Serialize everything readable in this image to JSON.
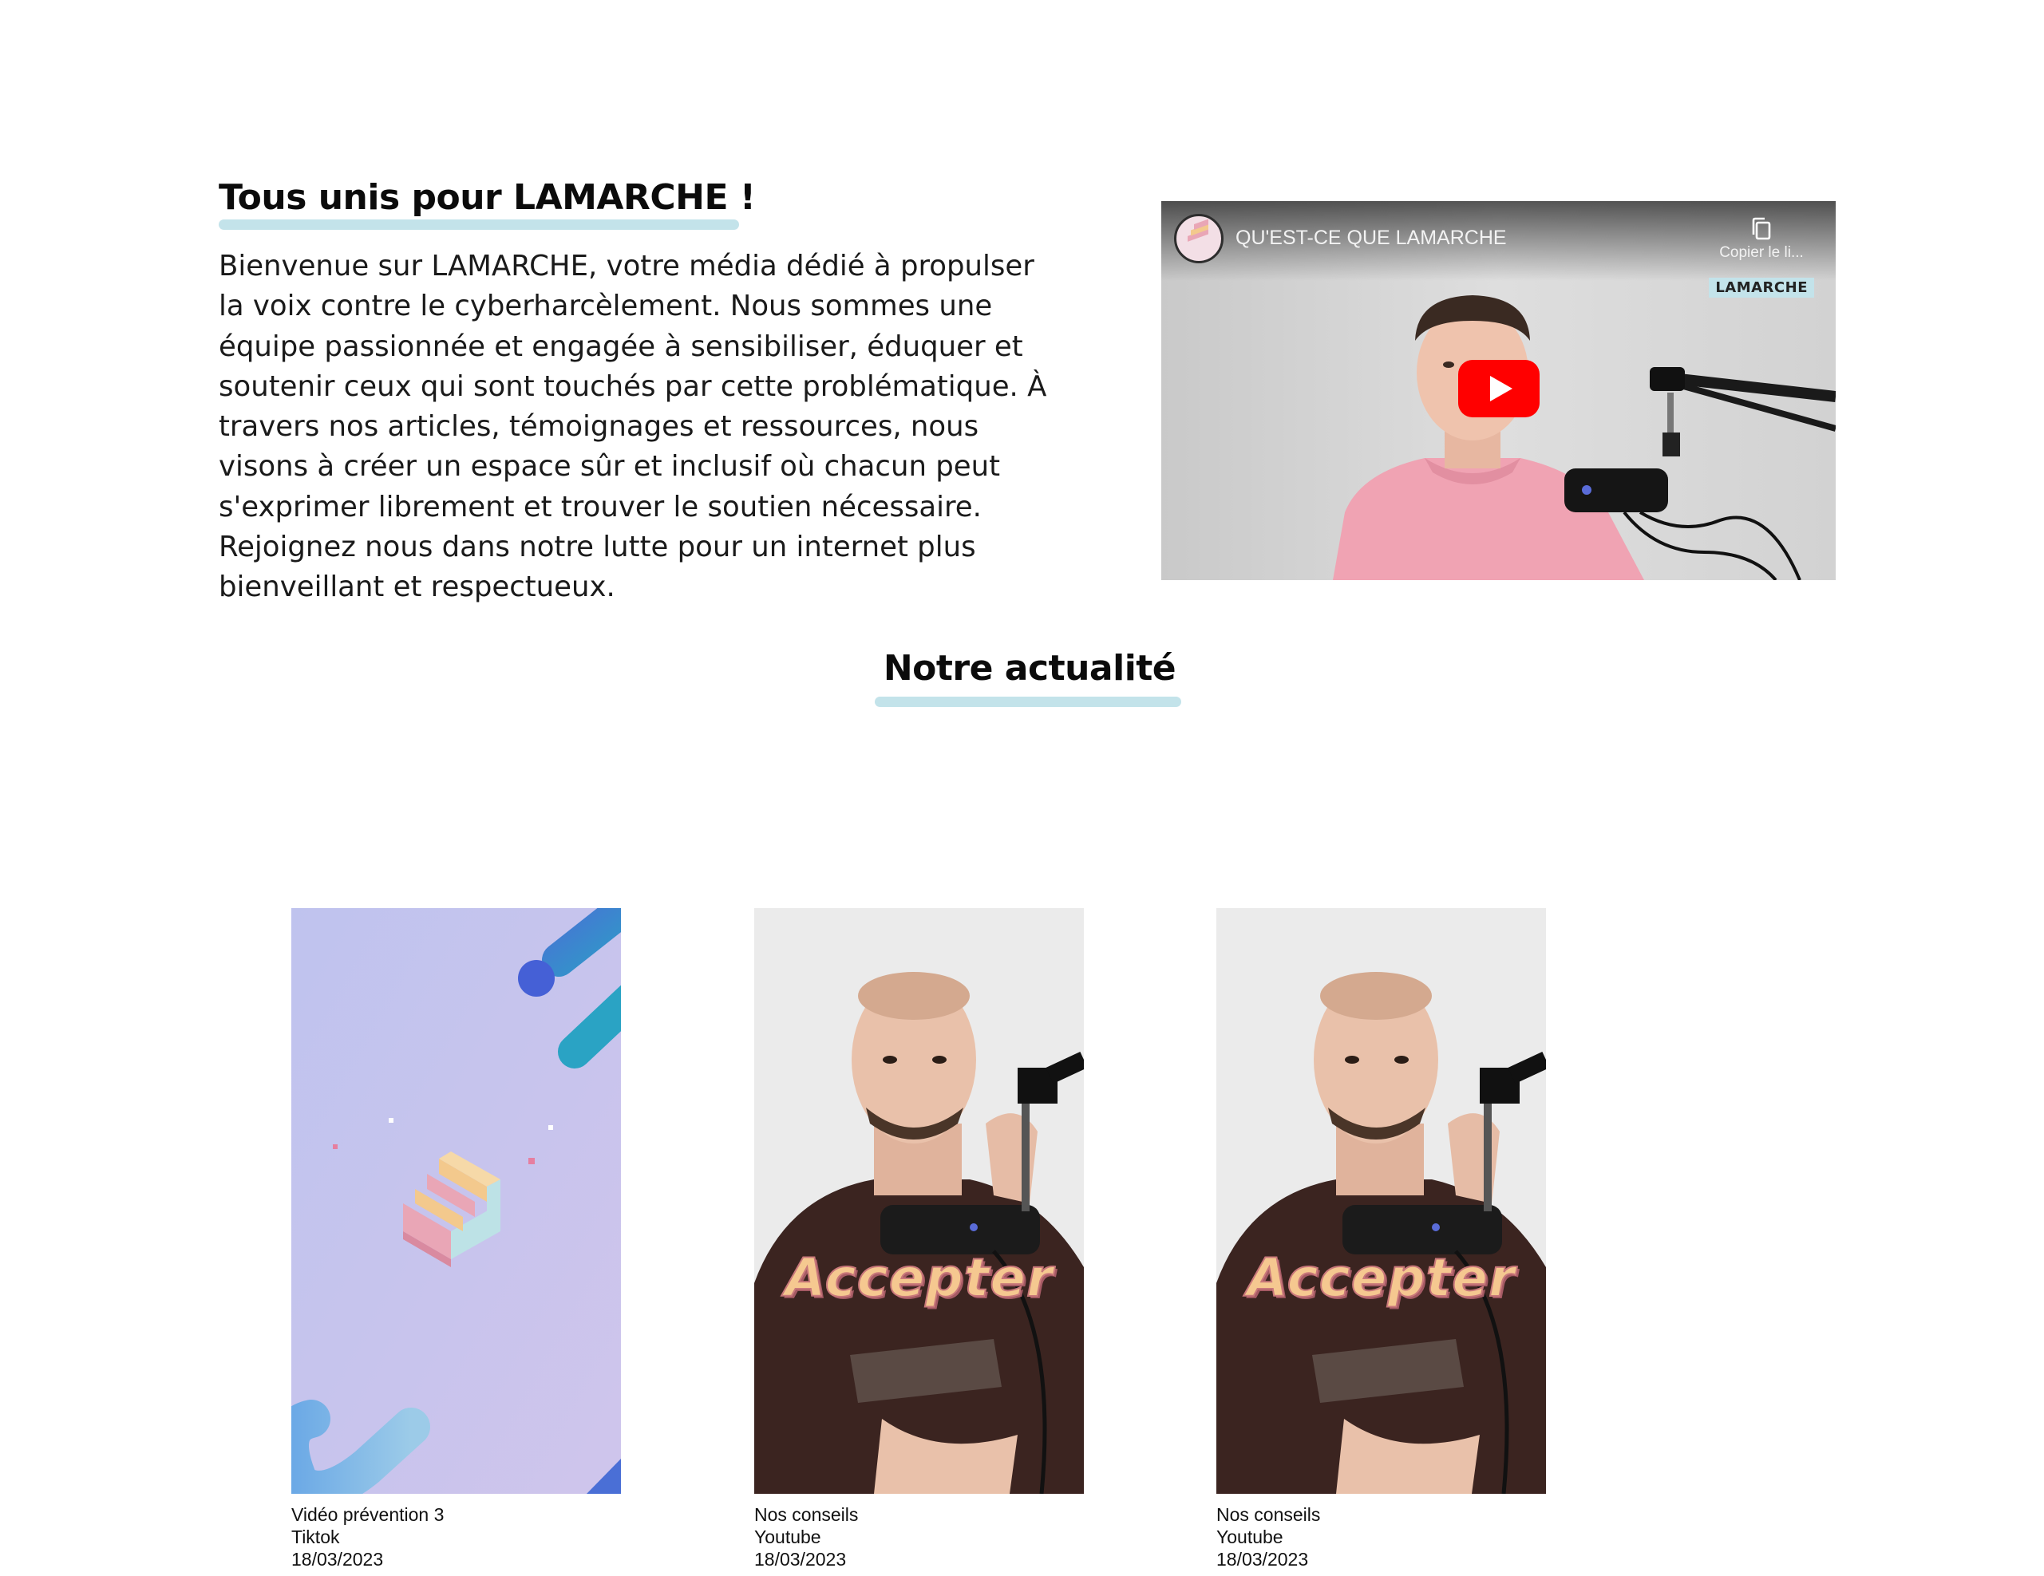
{
  "intro": {
    "title": "Tous unis pour LAMARCHE !",
    "text": "Bienvenue sur LAMARCHE, votre média dédié à propulser la voix contre le cyberharcèlement. Nous sommes une équipe passionnée et engagée à sensibiliser, éduquer et soutenir ceux qui sont touchés par cette problématique. À travers nos articles, témoignages et ressources, nous visons à créer un espace sûr et inclusif où chacun peut s'exprimer librement et trouver le soutien nécessaire. Rejoignez nous dans notre lutte pour un internet plus bienveillant et respectueux."
  },
  "video": {
    "title": "QU'EST-CE QUE LAMARCHE",
    "copy_label": "Copier le li...",
    "watermark": "LAMARCHE",
    "icons": [
      "channel-avatar",
      "copy-icon",
      "youtube-play-icon"
    ]
  },
  "news": {
    "title": "Notre actualité",
    "items": [
      {
        "title": "Vidéo prévention 3",
        "platform": "Tiktok",
        "date": "18/03/2023"
      },
      {
        "title": "Nos conseils",
        "platform": "Youtube",
        "date": "18/03/2023",
        "overlay_text": "Accepter"
      },
      {
        "title": "Nos conseils",
        "platform": "Youtube",
        "date": "18/03/2023",
        "overlay_text": "Accepter"
      }
    ]
  },
  "colors": {
    "underline": "#c3e3ea",
    "youtube_red": "#ff0000",
    "thumb_lavender": "#c4c6ec",
    "hoodie_brown": "#3b2420",
    "shirt_pink": "#f0a3b3"
  }
}
